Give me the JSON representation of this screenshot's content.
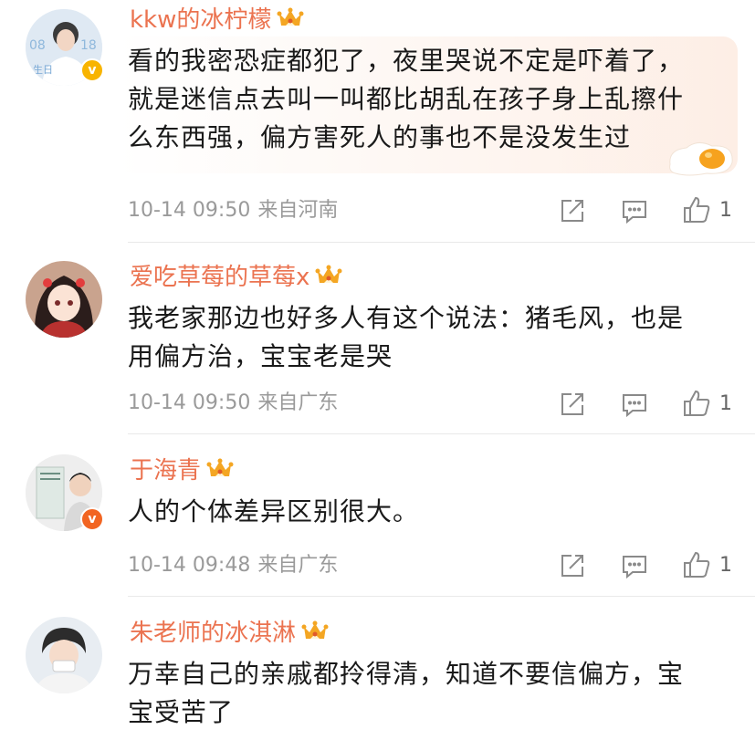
{
  "comments": [
    {
      "username": "kkw的冰柠檬",
      "text": "看的我密恐症都犯了，夜里哭说不定是吓着了，就是迷信点去叫一叫都比胡乱在孩子身上乱擦什么东西强，偏方害死人的事也不是没发生过",
      "lines": [
        "看的我密恐症都犯了，夜里哭说不定是吓着了，",
        "就是迷信点去叫一叫都比胡乱在孩子身上乱擦什",
        "么东西强，偏方害死人的事也不是没发生过"
      ],
      "time": "10-14 09:50",
      "location": "来自河南",
      "likes": "1",
      "verified": "yellow",
      "avatar_text": "0818 生日"
    },
    {
      "username": "爱吃草莓的草莓x",
      "lines": [
        "我老家那边也好多人有这个说法：猪毛风，也是",
        "用偏方治，宝宝老是哭"
      ],
      "time": "10-14 09:50",
      "location": "来自广东",
      "likes": "1",
      "verified": "none"
    },
    {
      "username": "于海青",
      "lines": [
        "人的个体差异区别很大。"
      ],
      "time": "10-14 09:48",
      "location": "来自广东",
      "likes": "1",
      "verified": "orange"
    },
    {
      "username": "朱老师的冰淇淋",
      "lines": [
        "万幸自己的亲戚都拎得清，知道不要信偏方，宝",
        "宝受苦了"
      ],
      "verified": "none"
    }
  ],
  "colors": {
    "username": "#eb7350",
    "meta": "#9a9a9a",
    "crown": "#f4a623",
    "verified_yellow": "#f8b400",
    "verified_orange": "#f26522"
  },
  "icons": {
    "share": "share-icon",
    "comment": "comment-icon",
    "like": "like-icon",
    "crown": "crown-badge-icon",
    "sticker": "fried-egg-sticker-icon"
  }
}
